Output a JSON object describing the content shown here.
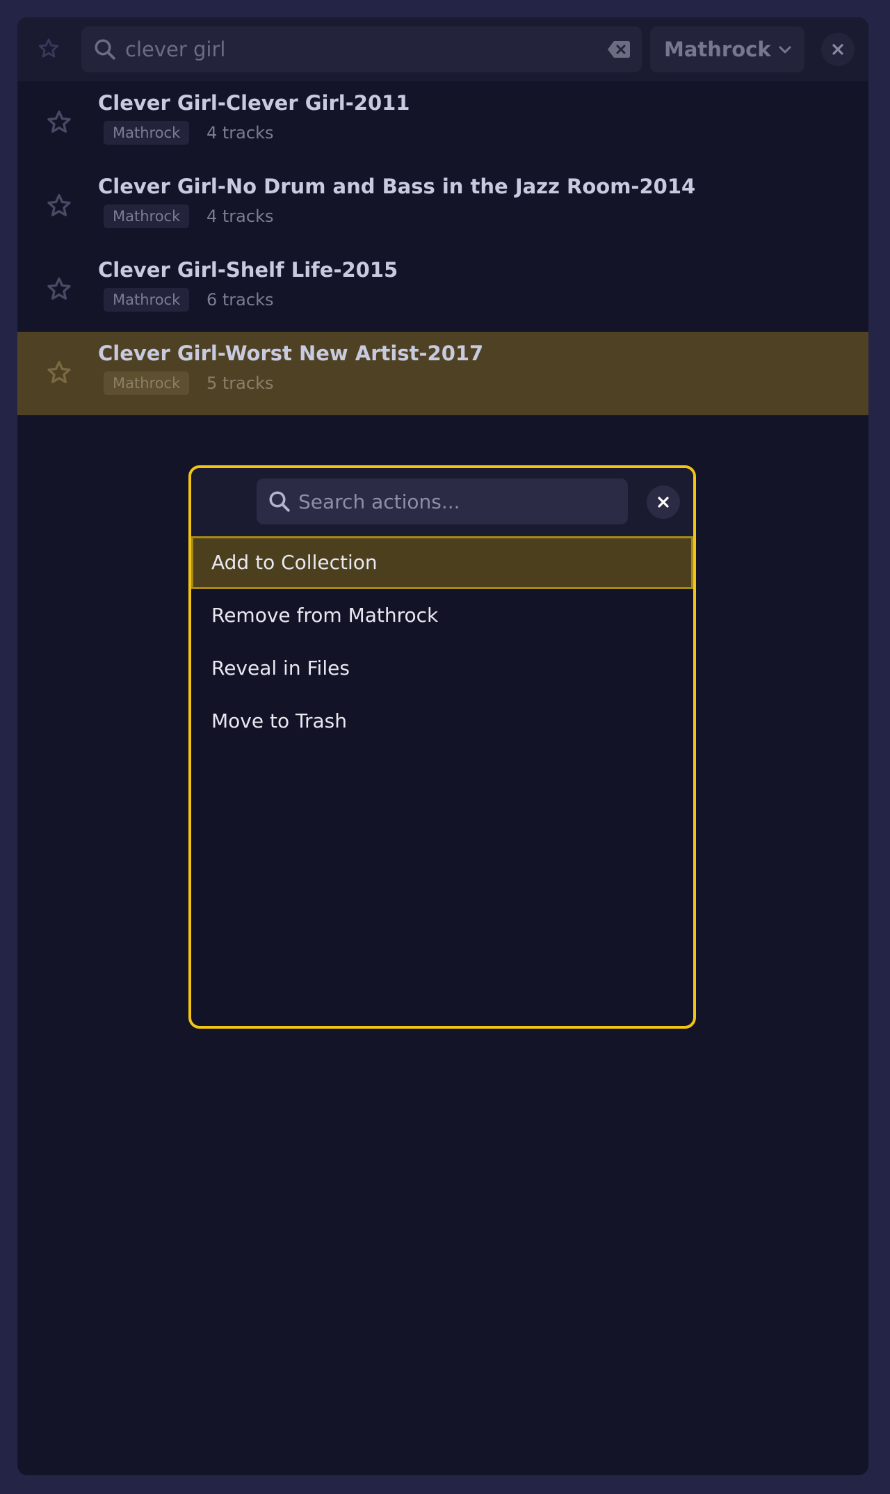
{
  "search": {
    "query": "clever girl"
  },
  "filter": {
    "label": "Mathrock"
  },
  "results": [
    {
      "title": "Clever Girl-Clever Girl-2011",
      "tag": "Mathrock",
      "tracks": "4 tracks",
      "highlighted": false
    },
    {
      "title": "Clever Girl-No Drum and Bass in the Jazz Room-2014",
      "tag": "Mathrock",
      "tracks": "4 tracks",
      "highlighted": false
    },
    {
      "title": "Clever Girl-Shelf Life-2015",
      "tag": "Mathrock",
      "tracks": "6 tracks",
      "highlighted": false
    },
    {
      "title": "Clever Girl-Worst New Artist-2017",
      "tag": "Mathrock",
      "tracks": "5 tracks",
      "highlighted": true
    }
  ],
  "action_menu": {
    "search_placeholder": "Search actions...",
    "actions": [
      {
        "label": "Add to Collection",
        "selected": true
      },
      {
        "label": "Remove from Mathrock",
        "selected": false
      },
      {
        "label": "Reveal in Files",
        "selected": false
      },
      {
        "label": "Move to Trash",
        "selected": false
      }
    ]
  },
  "colors": {
    "background": "#242447",
    "panel": "#141428",
    "accent": "#f2c514",
    "highlight_row": "#4f4224"
  },
  "icons": {
    "favorite": "star-icon",
    "search": "search-icon",
    "clear": "backspace-icon",
    "dropdown": "chevron-down-icon",
    "close": "close-icon"
  }
}
